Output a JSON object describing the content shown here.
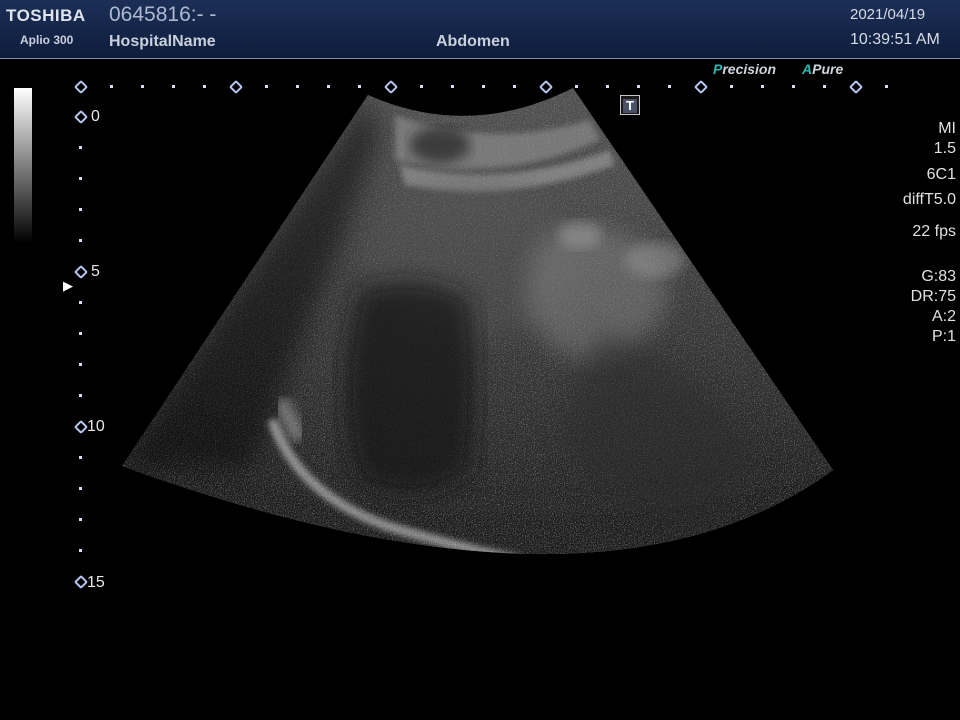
{
  "header": {
    "brand": "TOSHIBA",
    "model": "Aplio 300",
    "patient_id": "0645816:- -",
    "hospital": "HospitalName",
    "preset": "Abdomen",
    "date": "2021/04/19",
    "time": "10:39:51 AM"
  },
  "modes": {
    "precision_first": "P",
    "precision_rest": "recision",
    "apure_first": "A",
    "apure_rest": "Pure"
  },
  "depth_scale": {
    "labels": [
      "0",
      "5",
      "10",
      "15"
    ]
  },
  "tgc_button": "T",
  "params": {
    "mi_label": "MI",
    "mi_value": "1.5",
    "probe": "6C1",
    "mode": "diffT5.0",
    "fps": "22 fps",
    "gain": "G:83",
    "dynamic_range": "DR:75",
    "a": "A:2",
    "p": "P:1"
  },
  "colors": {
    "header_bg": "#142446",
    "accent_teal": "#2fb6b1",
    "marker_blue": "#b8c7f0"
  }
}
